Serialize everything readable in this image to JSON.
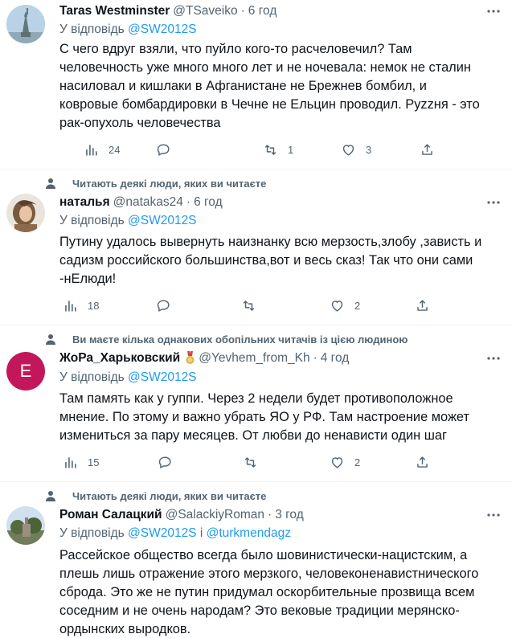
{
  "tweets": [
    {
      "name": "Taras Westminster",
      "handle": "@TSaveiko",
      "dot": "·",
      "time": "6 год",
      "reply_prefix": "У відповідь",
      "mentions": [
        "@SW2012S"
      ],
      "reply_joiner": "",
      "lines": [
        "С чего вдруг взяли, что пуйло кого-то расчеловечил? Там",
        "человечность уже много много лет и не ночевала: немок не сталин",
        "насиловал и кишлаки в Афганистане не Брежнев бомбил, и",
        "ковровые бомбардировки в Чечне не Ельцин проводил. Pуzzня - это",
        "рак-опухоль человечества"
      ],
      "stats": {
        "analytics": "24",
        "replies": "",
        "retweets": "1",
        "likes": "3"
      }
    },
    {
      "social_context": "Читають деякі люди, яких ви читаєте",
      "name": "наталья",
      "handle": "@natakas24",
      "dot": "·",
      "time": "6 год",
      "reply_prefix": "У відповідь",
      "mentions": [
        "@SW2012S"
      ],
      "reply_joiner": "",
      "lines": [
        "Путину удалось вывернуть  наизнанку всю мерзость,злобу ,зависть и",
        "садизм российского большинства,вот и весь сказ! Так что они сами",
        "-нЕлюди!"
      ],
      "stats": {
        "analytics": "18",
        "replies": "",
        "retweets": "",
        "likes": "2"
      }
    },
    {
      "social_context": "Ви маєте кілька однакових обопільних читачів із цією людиною",
      "name": "ЖоРа_Харьковский",
      "handle": "@Yevhem_from_Kh",
      "dot": "·",
      "time": "4 год",
      "avatar_letter": "E",
      "reply_prefix": "У відповідь",
      "mentions": [
        "@SW2012S"
      ],
      "reply_joiner": "",
      "lines": [
        "Там память как у гуппи. Через 2 недели будет противоположное",
        "мнение. По этому и важно убрать ЯО у РФ. Там настроение может",
        "измениться за пару месяцев. От любви до ненависти один шаг"
      ],
      "stats": {
        "analytics": "15",
        "replies": "",
        "retweets": "",
        "likes": "2"
      }
    },
    {
      "social_context": "Читають деякі люди, яких ви читаєте",
      "name": "Роман Салацкий",
      "handle": "@SalackiyRoman",
      "dot": "·",
      "time": "3 год",
      "reply_prefix": "У відповідь",
      "mentions": [
        "@SW2012S",
        "@turkmendagz"
      ],
      "reply_joiner": "і",
      "lines": [
        "Рассейское общество всегда было шовинистически-нацистским, а",
        "плешь лишь отражение этого мерзкого, человеконенавистнического",
        "сброда. Это же не путин придумал оскорбительные прозвища всем",
        "соседним и не очень народам? Это вековые традиции мерянско-",
        "ордынских выродков."
      ]
    }
  ],
  "colors": {
    "text": "#0f1419",
    "secondary": "#536471",
    "link": "#1d9bf0",
    "avatar_e": "#c2185b",
    "divider": "#eff3f4"
  },
  "icons": [
    "person-icon",
    "more-icon",
    "analytics-icon",
    "reply-icon",
    "retweet-icon",
    "like-icon",
    "share-icon",
    "medal-badge-icon"
  ]
}
